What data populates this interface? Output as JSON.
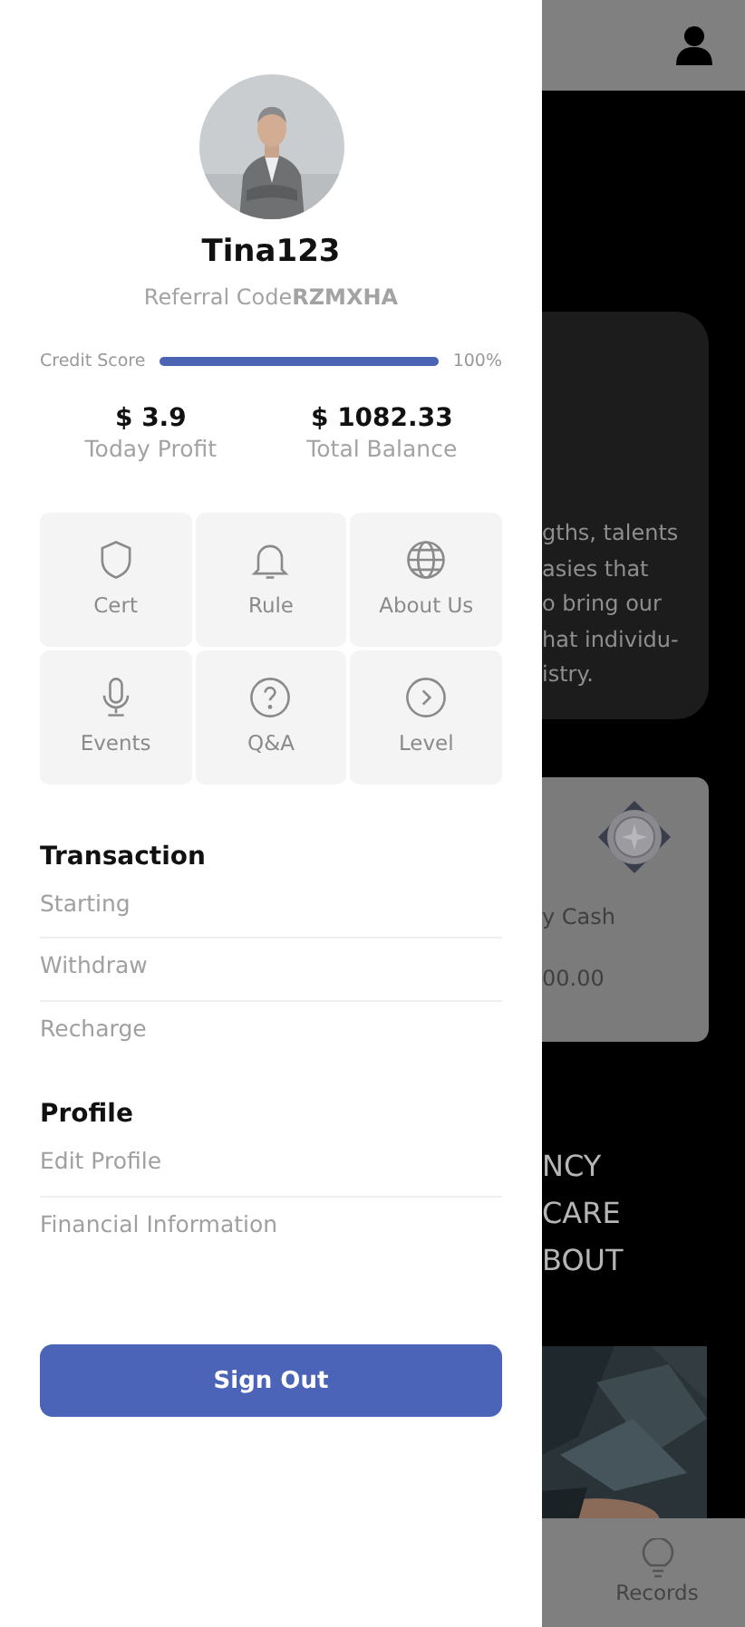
{
  "drawer": {
    "username": "Tina123",
    "referral": {
      "label": "Referral Code",
      "code": "RZMXHA"
    },
    "credit_score": {
      "label": "Credit Score",
      "level": 1,
      "reading": "100%"
    },
    "stats": [
      {
        "value": "$ 3.9",
        "label": "Today Profit"
      },
      {
        "value": "$ 1082.33",
        "label": "Total Balance"
      }
    ],
    "shortcuts": [
      {
        "kind": "shield",
        "label": "Cert"
      },
      {
        "kind": "bell",
        "label": "Rule"
      },
      {
        "kind": "globe",
        "label": "About Us"
      },
      {
        "kind": "mic",
        "label": "Events"
      },
      {
        "kind": "question",
        "label": "Q&A"
      },
      {
        "kind": "chevron",
        "label": "Level"
      }
    ],
    "sections": [
      {
        "title": "Transaction",
        "items": [
          "Starting",
          "Withdraw",
          "Recharge"
        ]
      },
      {
        "title": "Profile",
        "items": [
          "Edit Profile",
          "Financial Information"
        ]
      }
    ],
    "sign_out": "Sign Out"
  },
  "background": {
    "intro_lines": [
      "gths, talents",
      "asies that",
      "o bring our",
      "hat individu-",
      "istry."
    ],
    "cash_card": {
      "label": "y Cash",
      "amount": "00.00"
    },
    "headline_lines": [
      "NCY",
      "CARE",
      "BOUT"
    ],
    "bottom_nav": {
      "label": "Records"
    }
  }
}
